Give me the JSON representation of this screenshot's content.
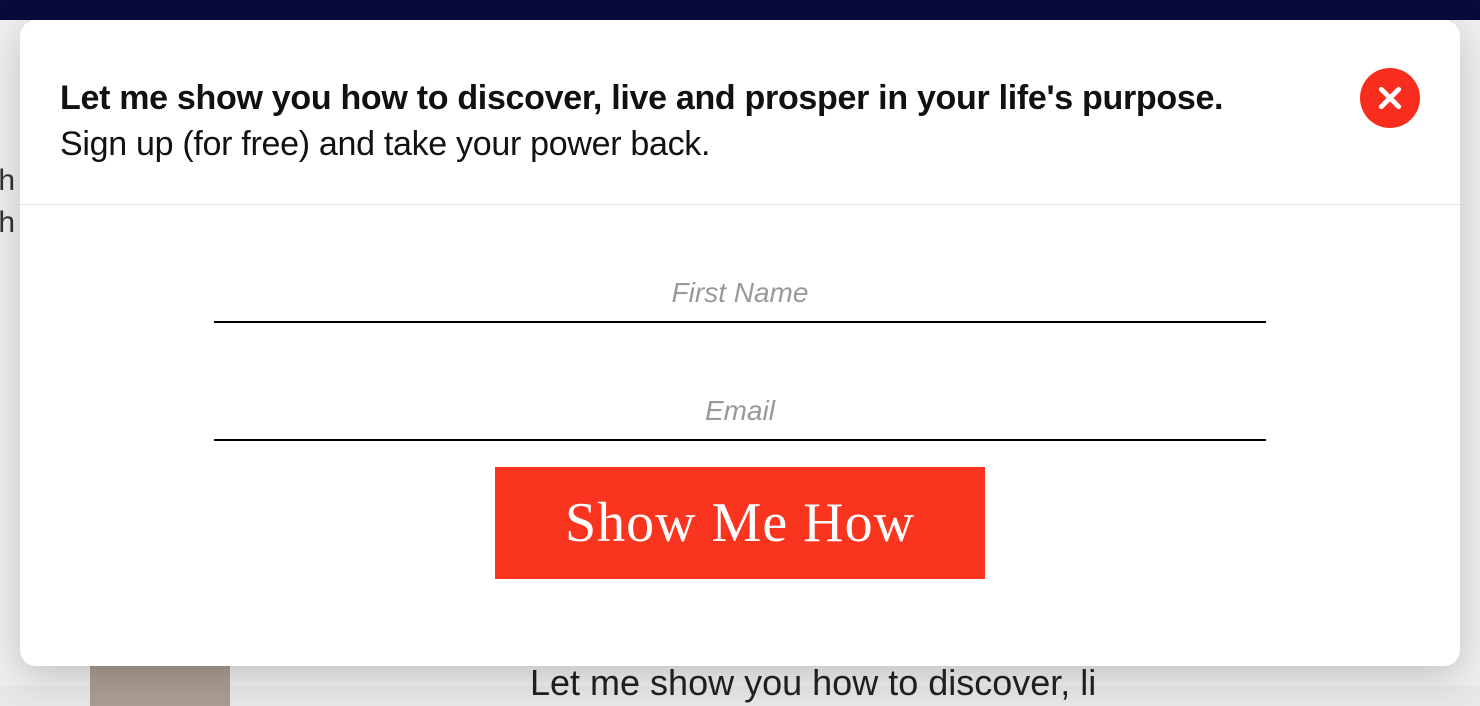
{
  "background": {
    "partial_left_text_1": "th",
    "partial_left_text_2": "th",
    "partial_bottom_text": "Let me show you how to discover, li"
  },
  "modal": {
    "headline": "Let me show you how to discover, live and prosper in your life's purpose.",
    "subheadline": "Sign up (for free) and take your power back.",
    "close_label": "Close",
    "form": {
      "first_name_placeholder": "First Name",
      "email_placeholder": "Email",
      "submit_label": "Show Me How"
    }
  },
  "colors": {
    "accent": "#f9351f",
    "text": "#111"
  }
}
